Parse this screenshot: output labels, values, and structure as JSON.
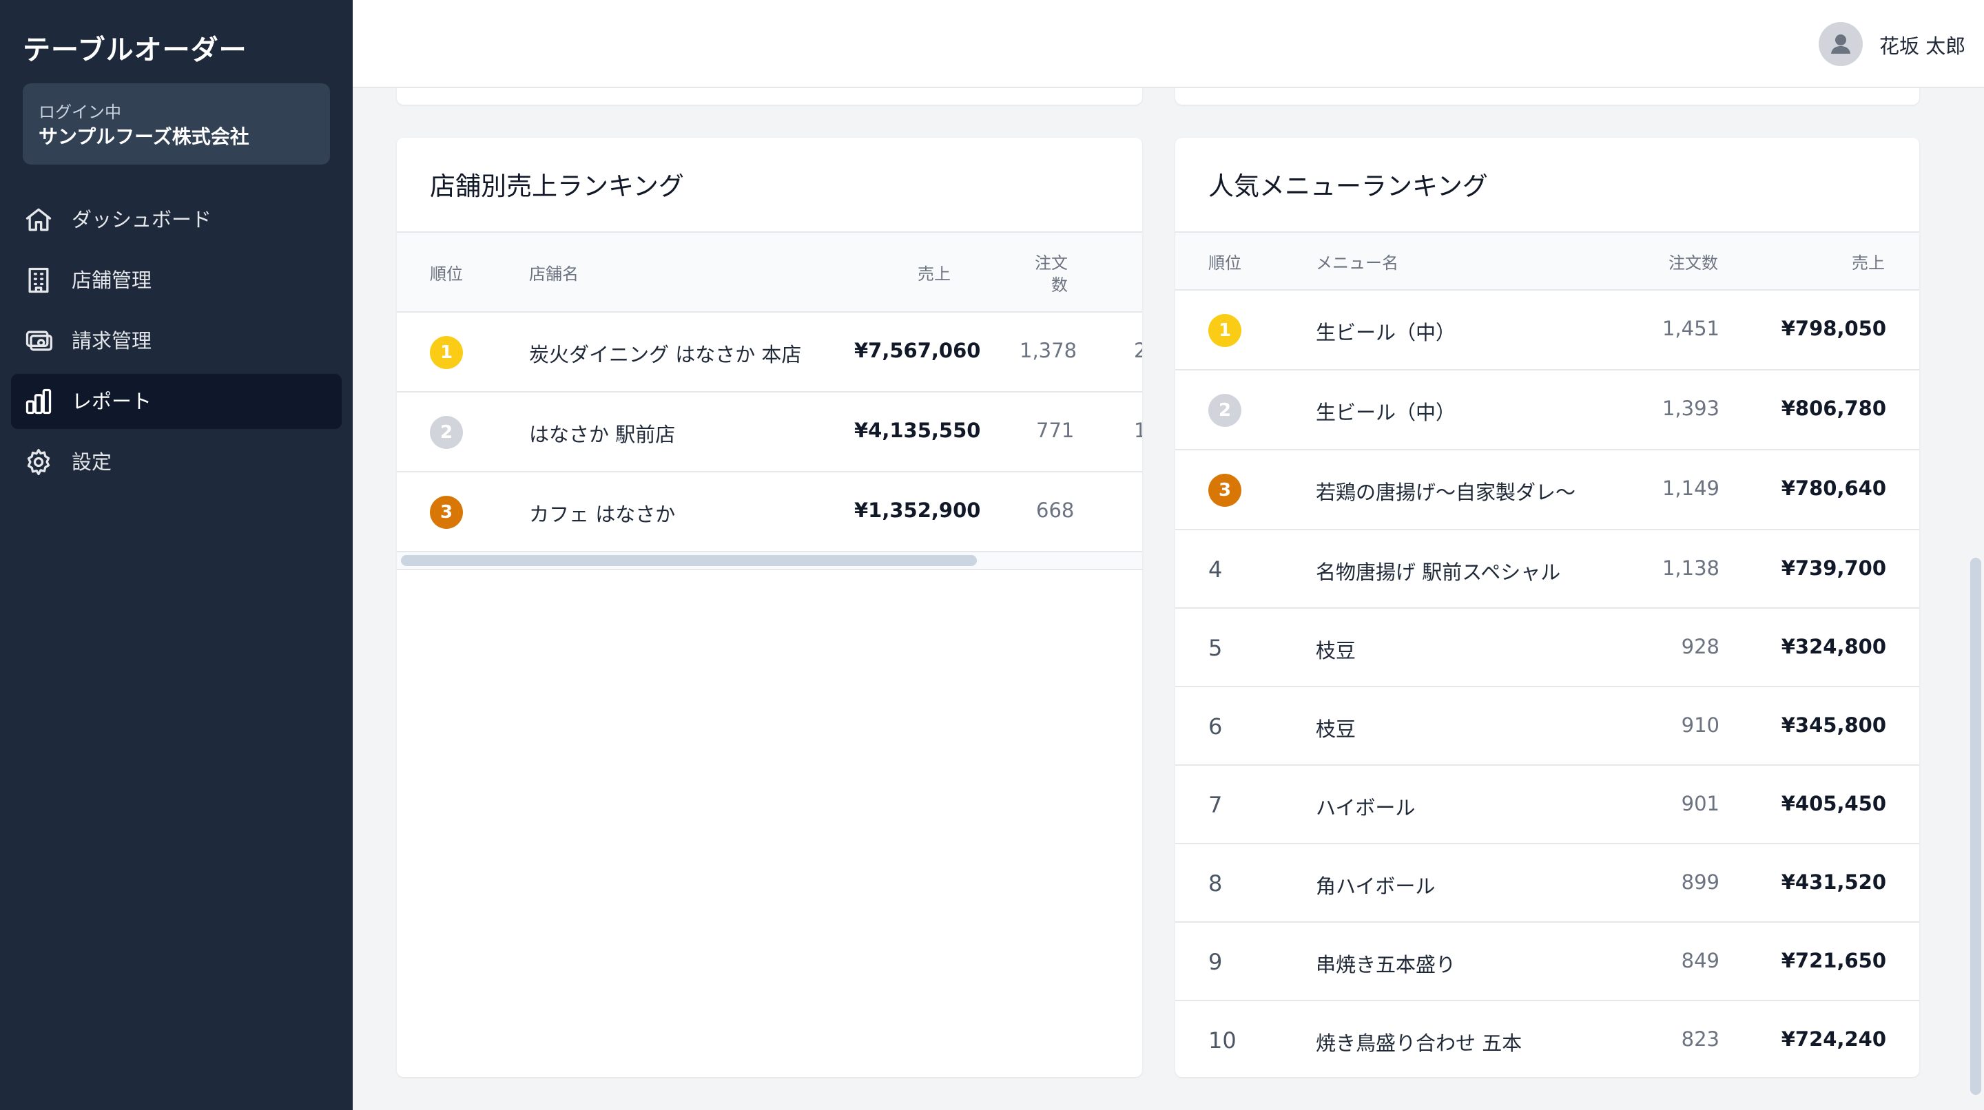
{
  "app": {
    "title": "テーブルオーダー"
  },
  "login": {
    "label": "ログイン中",
    "company": "サンプルフーズ株式会社"
  },
  "nav": [
    {
      "label": "ダッシュボード",
      "icon": "home-icon"
    },
    {
      "label": "店舗管理",
      "icon": "building-icon"
    },
    {
      "label": "請求管理",
      "icon": "billing-icon"
    },
    {
      "label": "レポート",
      "icon": "bar-chart-icon",
      "active": true
    },
    {
      "label": "設定",
      "icon": "gear-icon"
    }
  ],
  "header": {
    "user_name": "花坂 太郎"
  },
  "store_ranking": {
    "title": "店舗別売上ランキング",
    "headers": {
      "rank": "順位",
      "store": "店舗名",
      "sales": "売上",
      "orders_line1": "注文",
      "orders_line2": "数"
    },
    "rows": [
      {
        "rank": "1",
        "store": "炭火ダイニング はなさか 本店",
        "sales": "¥7,567,060",
        "orders": "1,378",
        "extra": "2"
      },
      {
        "rank": "2",
        "store": "はなさか 駅前店",
        "sales": "¥4,135,550",
        "orders": "771",
        "extra": "1"
      },
      {
        "rank": "3",
        "store": "カフェ はなさか",
        "sales": "¥1,352,900",
        "orders": "668",
        "extra": ""
      }
    ]
  },
  "menu_ranking": {
    "title": "人気メニューランキング",
    "headers": {
      "rank": "順位",
      "menu": "メニュー名",
      "orders": "注文数",
      "sales": "売上"
    },
    "rows": [
      {
        "rank": "1",
        "menu": "生ビール（中）",
        "orders": "1,451",
        "sales": "¥798,050"
      },
      {
        "rank": "2",
        "menu": "生ビール（中）",
        "orders": "1,393",
        "sales": "¥806,780"
      },
      {
        "rank": "3",
        "menu": "若鶏の唐揚げ〜自家製ダレ〜",
        "orders": "1,149",
        "sales": "¥780,640"
      },
      {
        "rank": "4",
        "menu": "名物唐揚げ 駅前スペシャル",
        "orders": "1,138",
        "sales": "¥739,700"
      },
      {
        "rank": "5",
        "menu": "枝豆",
        "orders": "928",
        "sales": "¥324,800"
      },
      {
        "rank": "6",
        "menu": "枝豆",
        "orders": "910",
        "sales": "¥345,800"
      },
      {
        "rank": "7",
        "menu": "ハイボール",
        "orders": "901",
        "sales": "¥405,450"
      },
      {
        "rank": "8",
        "menu": "角ハイボール",
        "orders": "899",
        "sales": "¥431,520"
      },
      {
        "rank": "9",
        "menu": "串焼き五本盛り",
        "orders": "849",
        "sales": "¥721,650"
      },
      {
        "rank": "10",
        "menu": "焼き鳥盛り合わせ 五本",
        "orders": "823",
        "sales": "¥724,240"
      }
    ]
  },
  "colors": {
    "gold": "#facc15",
    "silver": "#d1d5db",
    "bronze": "#d97706",
    "sidebar": "#1e293b"
  }
}
